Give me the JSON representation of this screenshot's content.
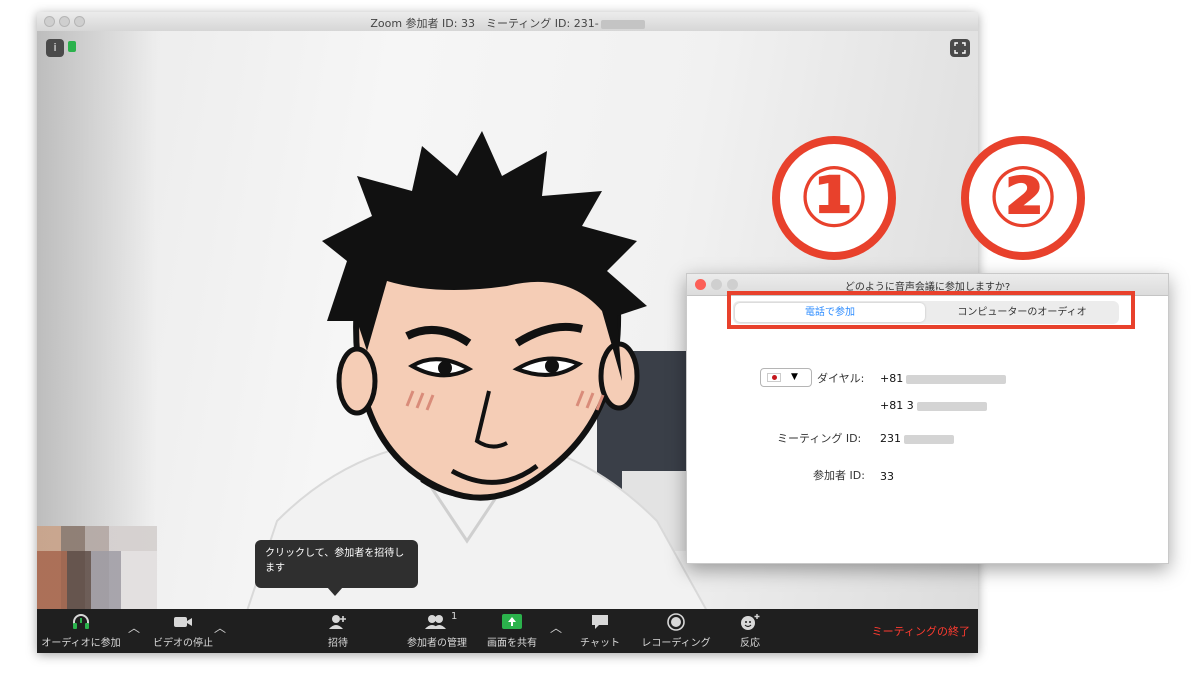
{
  "window": {
    "title": "Zoom 参加者 ID: 33　ミーティング ID: 231-"
  },
  "video": {
    "tooltip": "クリックして、参加者を招待します"
  },
  "toolbar": {
    "join_audio": "オーディオに参加",
    "stop_video": "ビデオの停止",
    "invite": "招待",
    "participants": "参加者の管理",
    "participant_count": "1",
    "share": "画面を共有",
    "chat": "チャット",
    "record": "レコーディング",
    "reactions": "反応",
    "end": "ミーティングの終了"
  },
  "annotations": {
    "num1": "①",
    "num2": "②",
    "accent_color": "#e8412c"
  },
  "dialog": {
    "title": "どのように音声会議に参加しますか?",
    "tab_phone": "電話で参加",
    "tab_computer": "コンピューターのオーディオ",
    "dial_label": "ダイヤル:",
    "dial_number1": "+81",
    "dial_number2": "+81 3",
    "meeting_id_label": "ミーティング ID:",
    "meeting_id": "231",
    "participant_id_label": "参加者 ID:",
    "participant_id": "33",
    "active_tab_color": "#2d8cff"
  }
}
